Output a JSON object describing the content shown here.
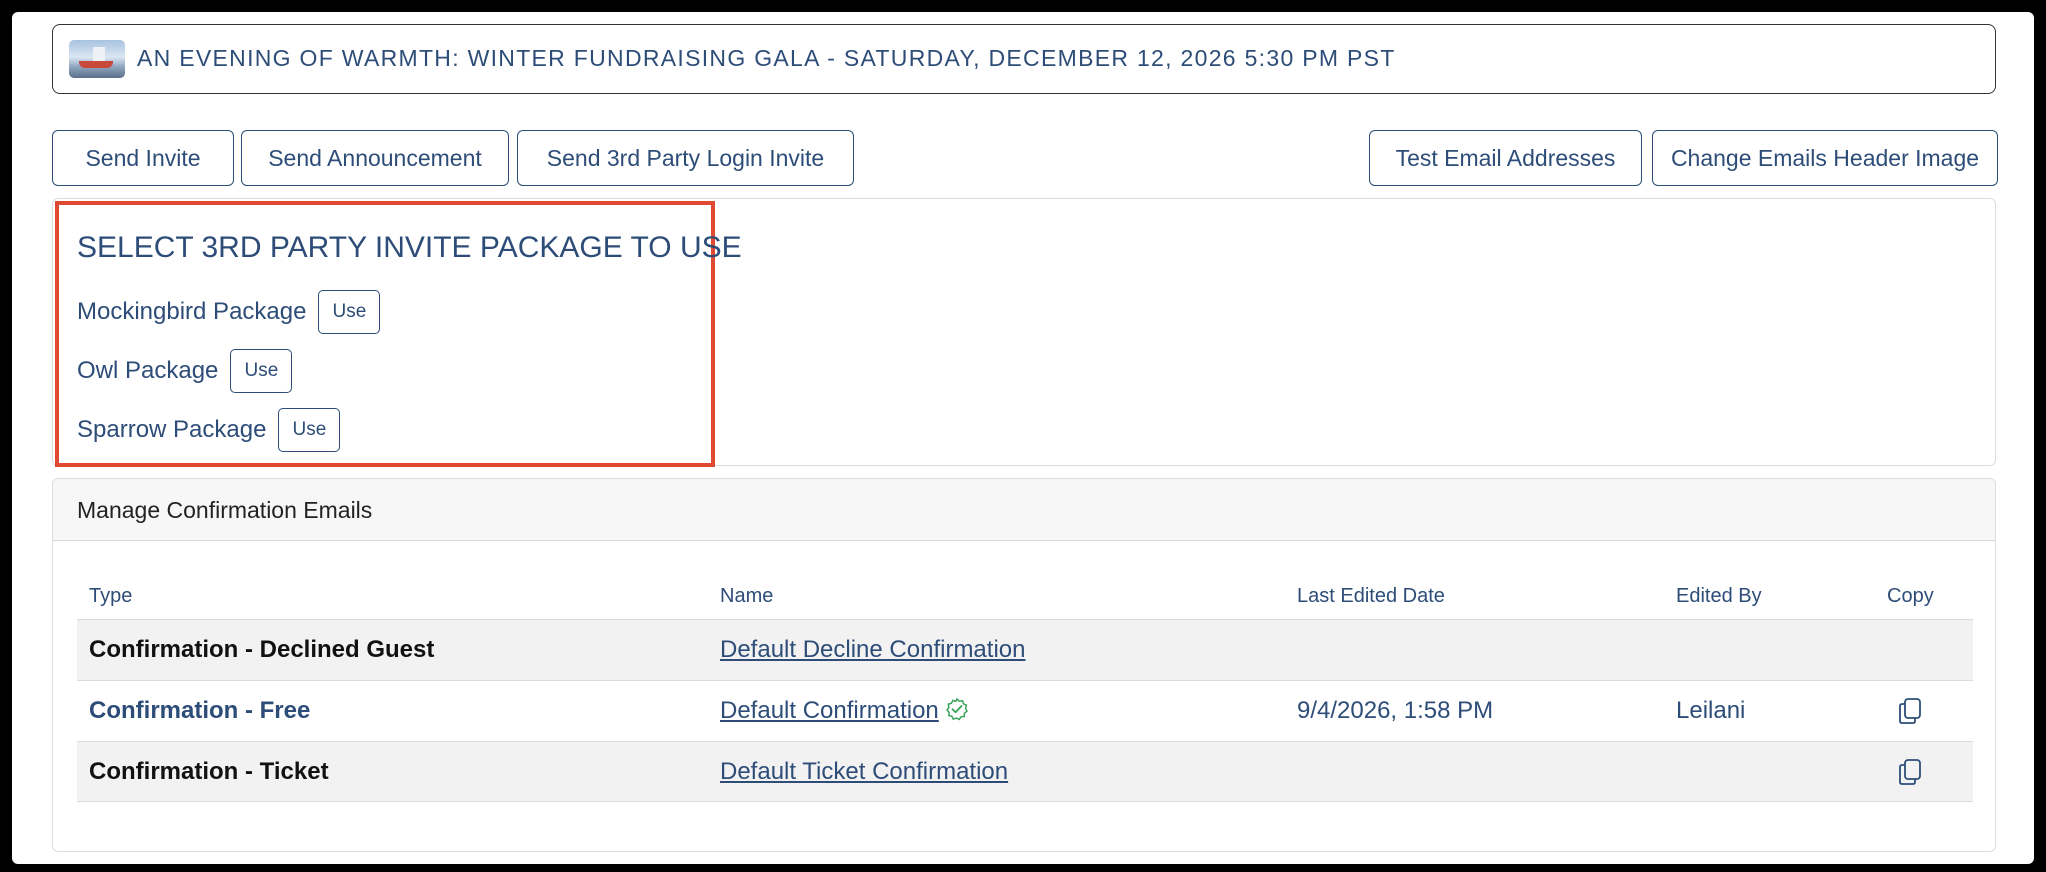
{
  "event": {
    "title": "AN EVENING OF WARMTH: WINTER FUNDRAISING GALA - SATURDAY, DECEMBER 12, 2026 5:30 PM PST",
    "thumbnail_icon": "event-thumbnail-image"
  },
  "actions": {
    "send_invite": "Send Invite",
    "send_announcement": "Send Announcement",
    "send_3rd_party": "Send 3rd Party Login Invite",
    "test_email": "Test Email Addresses",
    "change_header": "Change Emails Header Image"
  },
  "packages": {
    "heading": "SELECT 3RD PARTY INVITE PACKAGE TO USE",
    "use_label": "Use",
    "items": [
      {
        "name": "Mockingbird Package"
      },
      {
        "name": "Owl Package"
      },
      {
        "name": "Sparrow Package"
      }
    ],
    "highlight_color": "#e04a33"
  },
  "confirmations": {
    "title": "Manage Confirmation Emails",
    "columns": [
      "Type",
      "Name",
      "Last Edited Date",
      "Edited By",
      "Copy"
    ],
    "rows": [
      {
        "type": "Confirmation - Declined Guest",
        "name": "Default Decline Confirmation ",
        "date": "",
        "edited_by": "",
        "copy": false,
        "active": false,
        "verified": false
      },
      {
        "type": "Confirmation - Free",
        "name": "Default Confirmation ",
        "date": "9/4/2026, 1:58 PM",
        "edited_by": "Leilani",
        "copy": true,
        "active": true,
        "verified": true
      },
      {
        "type": "Confirmation - Ticket",
        "name": "Default Ticket Confirmation ",
        "date": "",
        "edited_by": "",
        "copy": true,
        "active": false,
        "verified": false
      }
    ]
  },
  "colors": {
    "primary": "#2d4d78",
    "check": "#3aa35a"
  }
}
